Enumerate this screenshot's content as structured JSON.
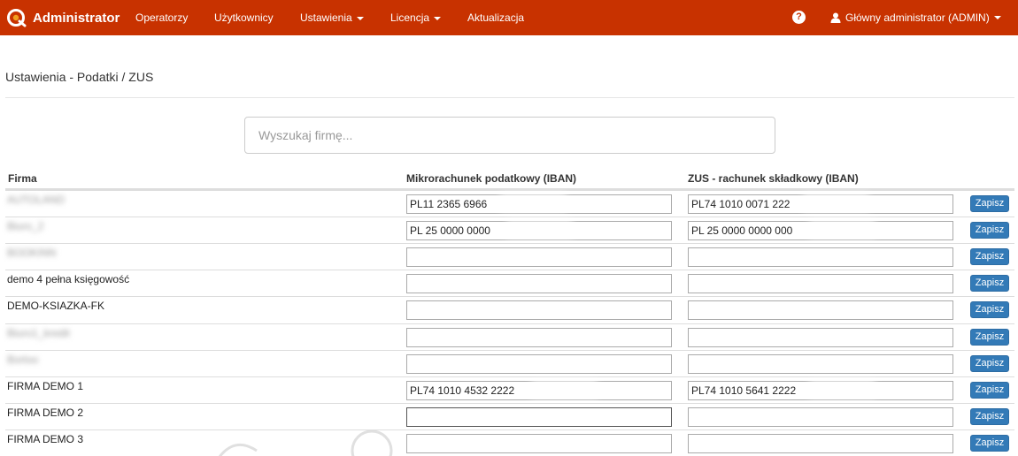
{
  "navbar": {
    "brand": "Administrator",
    "items": [
      {
        "label": "Operatorzy",
        "dropdown": false
      },
      {
        "label": "Użytkownicy",
        "dropdown": false
      },
      {
        "label": "Ustawienia",
        "dropdown": true
      },
      {
        "label": "Licencja",
        "dropdown": true
      },
      {
        "label": "Aktualizacja",
        "dropdown": false
      }
    ],
    "help_icon": "question-circle-icon",
    "user": "Główny administrator (ADMIN)",
    "color": "#c83200"
  },
  "page": {
    "title": "Ustawienia - Podatki / ZUS",
    "search_placeholder": "Wyszukaj firmę..."
  },
  "table": {
    "headers": {
      "firma": "Firma",
      "iban_tax": "Mikrorachunek podatkowy (IBAN)",
      "iban_zus": "ZUS - rachunek składkowy (IBAN)"
    },
    "save_label": "Zapisz",
    "rows": [
      {
        "firma": "AUTOLAND",
        "iban_tax": "PL11 2365 6966",
        "iban_zus": "PL74 1010 0071 222"
      },
      {
        "firma": "Biuro_2",
        "iban_tax": "PL 25 0000 0000",
        "iban_zus": "PL 25 0000 0000 000"
      },
      {
        "firma": "BOOKINN",
        "iban_tax": "",
        "iban_zus": ""
      },
      {
        "firma": "demo 4 pełna księgowość",
        "iban_tax": "",
        "iban_zus": ""
      },
      {
        "firma": "DEMO-KSIAZKA-FK",
        "iban_tax": "",
        "iban_zus": ""
      },
      {
        "firma": "Biuro1_kredit",
        "iban_tax": "",
        "iban_zus": ""
      },
      {
        "firma": "Bortoo",
        "iban_tax": "",
        "iban_zus": ""
      },
      {
        "firma": "FIRMA DEMO 1",
        "iban_tax": "PL74 1010 4532 2222",
        "iban_zus": "PL74 1010 5641 2222"
      },
      {
        "firma": "FIRMA DEMO 2",
        "iban_tax": "",
        "iban_zus": ""
      },
      {
        "firma": "FIRMA DEMO 3",
        "iban_tax": "",
        "iban_zus": ""
      }
    ]
  }
}
